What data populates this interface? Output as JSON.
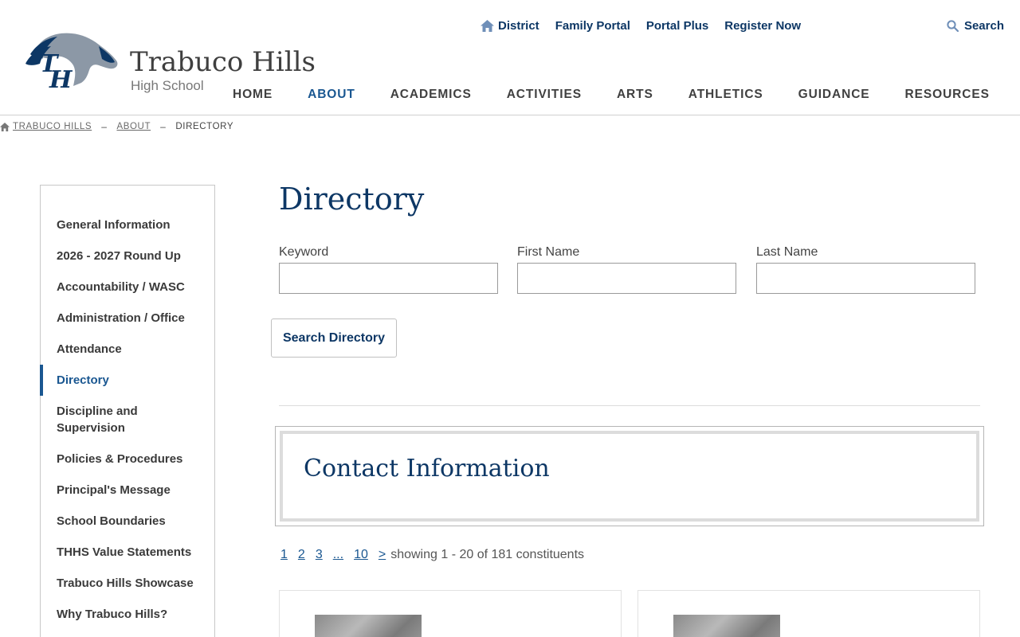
{
  "brand": {
    "name": "Trabuco Hills",
    "subtitle": "High School",
    "logo_icon": "mustang-th-logo-icon",
    "primary_color": "#0d3765",
    "accent_color": "#1a5791"
  },
  "util_nav": [
    {
      "label": "District",
      "icon": "home-icon"
    },
    {
      "label": "Family Portal"
    },
    {
      "label": "Portal Plus"
    },
    {
      "label": "Register Now"
    }
  ],
  "search": {
    "label": "Search",
    "icon": "search-icon"
  },
  "main_nav": [
    {
      "label": "HOME",
      "active": false
    },
    {
      "label": "ABOUT",
      "active": true
    },
    {
      "label": "ACADEMICS",
      "active": false
    },
    {
      "label": "ACTIVITIES",
      "active": false
    },
    {
      "label": "ARTS",
      "active": false
    },
    {
      "label": "ATHLETICS",
      "active": false
    },
    {
      "label": "GUIDANCE",
      "active": false
    },
    {
      "label": "RESOURCES",
      "active": false
    }
  ],
  "breadcrumb": {
    "home": "TRABUCO HILLS",
    "parent": "ABOUT",
    "current": "DIRECTORY",
    "separator": "–"
  },
  "sidebar": {
    "items": [
      {
        "label": "General Information",
        "active": false
      },
      {
        "label": "2026 - 2027 Round Up",
        "active": false
      },
      {
        "label": "Accountability / WASC",
        "active": false
      },
      {
        "label": "Administration / Office",
        "active": false
      },
      {
        "label": "Attendance",
        "active": false
      },
      {
        "label": "Directory",
        "active": true
      },
      {
        "label": "Discipline and Supervision",
        "active": false
      },
      {
        "label": "Policies & Procedures",
        "active": false
      },
      {
        "label": "Principal's Message",
        "active": false
      },
      {
        "label": "School Boundaries",
        "active": false
      },
      {
        "label": "THHS Value Statements",
        "active": false
      },
      {
        "label": "Trabuco Hills Showcase",
        "active": false
      },
      {
        "label": "Why Trabuco Hills?",
        "active": false
      }
    ]
  },
  "main": {
    "title": "Directory",
    "fields": {
      "keyword": {
        "label": "Keyword",
        "value": ""
      },
      "first_name": {
        "label": "First Name",
        "value": ""
      },
      "last_name": {
        "label": "Last Name",
        "value": ""
      }
    },
    "search_button": "Search Directory",
    "contact_title": "Contact Information",
    "pager": {
      "pages": [
        "1",
        "2",
        "3",
        "...",
        "10",
        ">"
      ],
      "summary": "showing 1 - 20 of 181 constituents"
    }
  }
}
